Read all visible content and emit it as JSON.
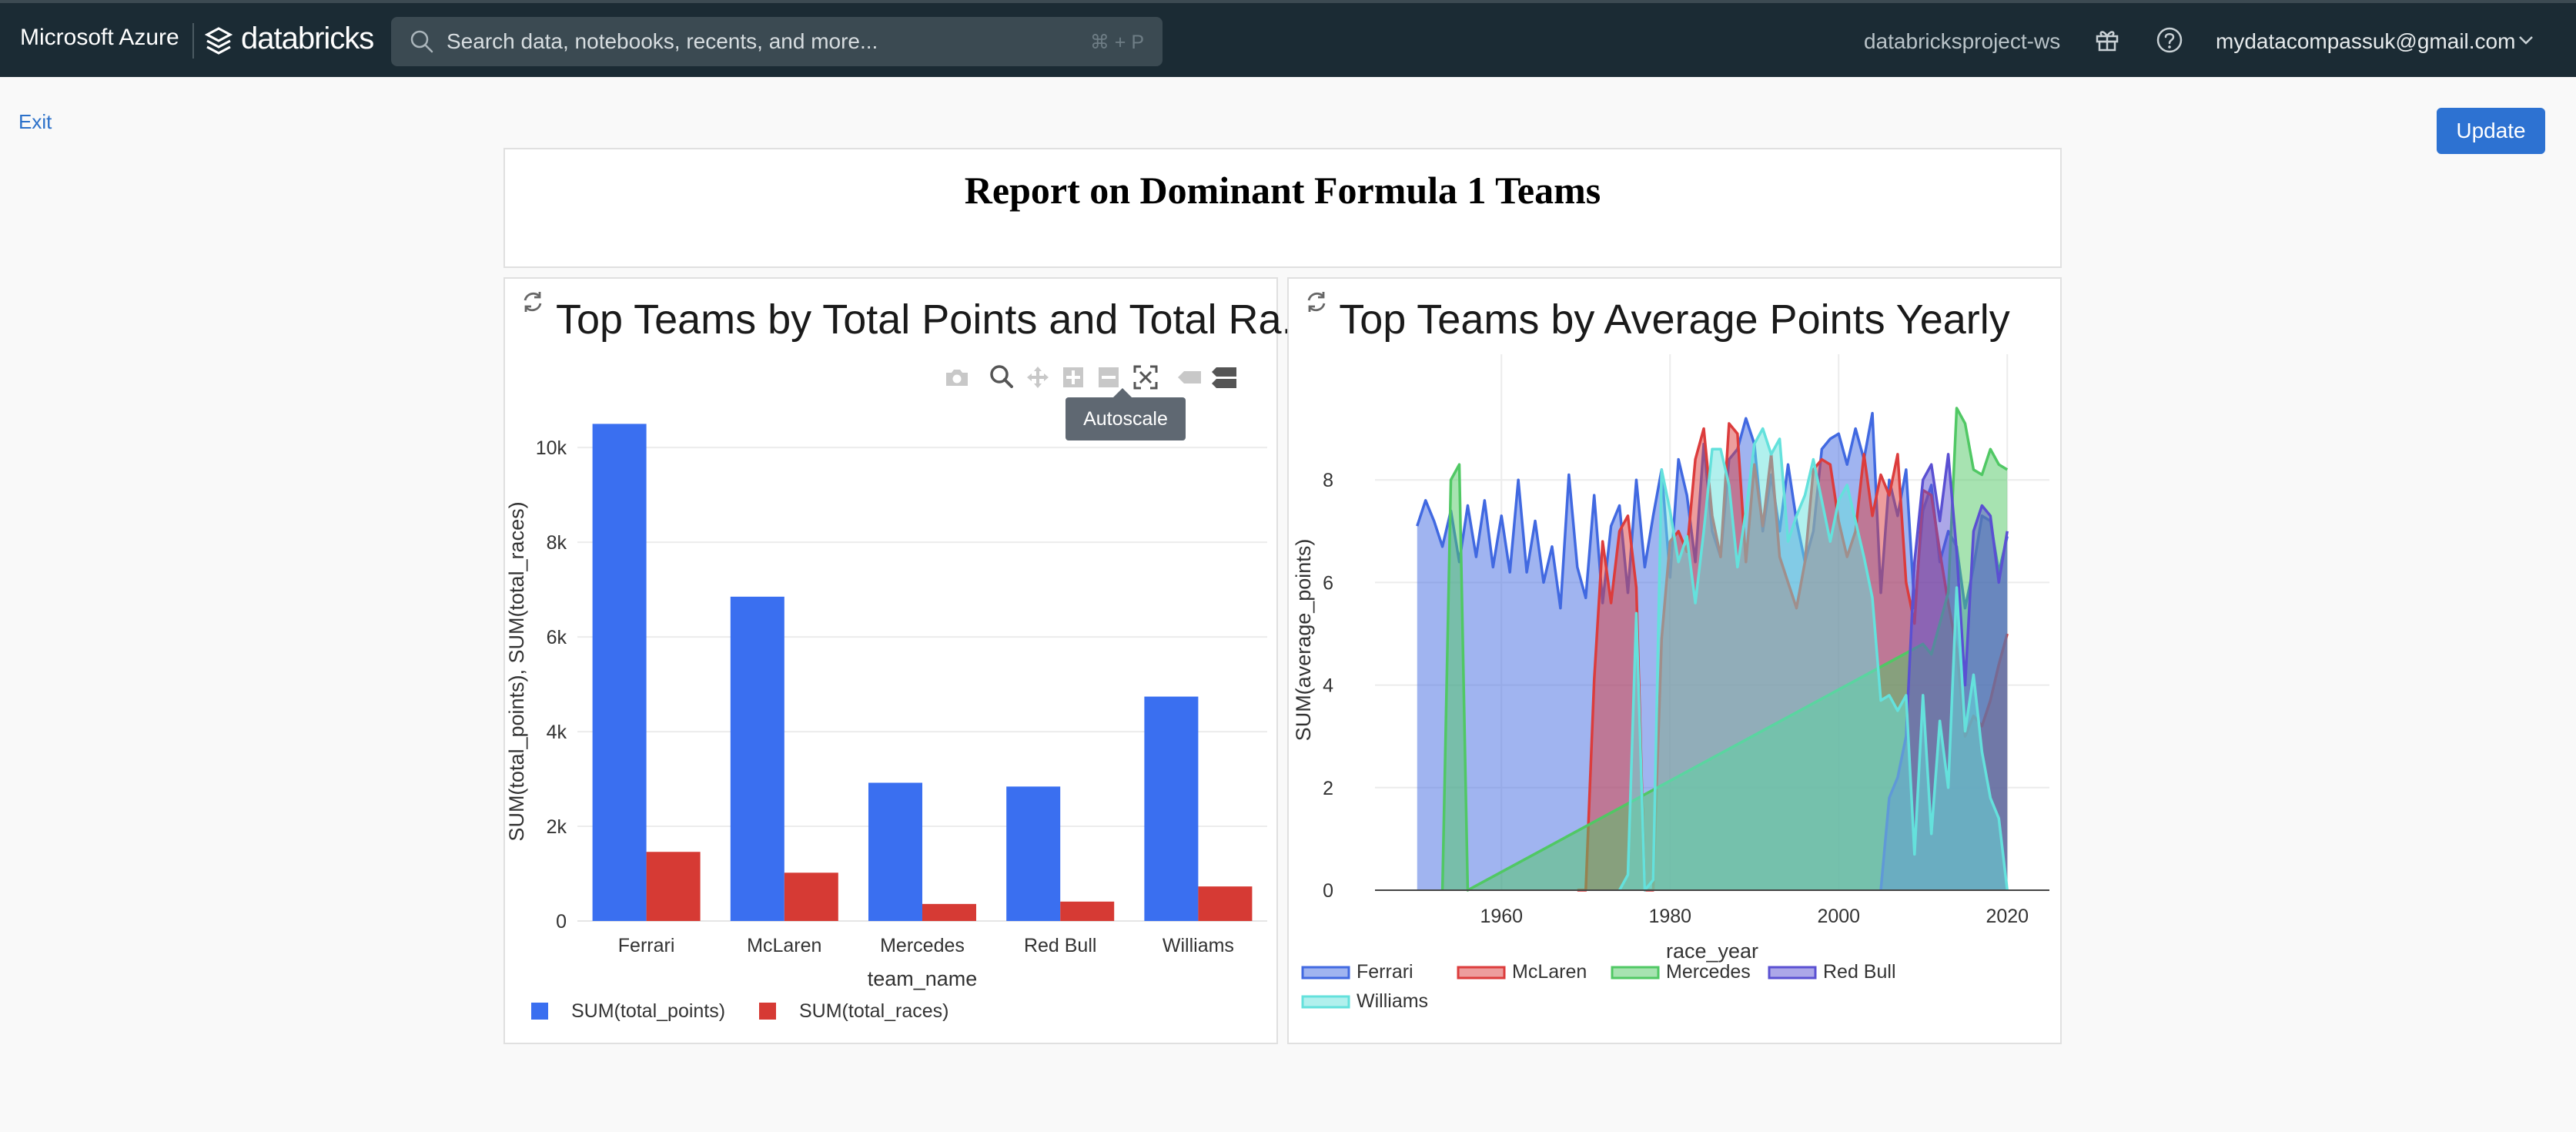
{
  "topbar": {
    "brand": "Microsoft Azure",
    "product": "databricks",
    "search_placeholder": "Search data, notebooks, recents, and more...",
    "search_shortcut": "⌘ + P",
    "workspace": "databricksproject-ws",
    "user": "mydatacompassuk@gmail.com",
    "icons": [
      "databricks-logo-icon",
      "search-icon",
      "gift-icon",
      "help-icon",
      "chevron-down-icon"
    ]
  },
  "dashboard": {
    "exit_label": "Exit",
    "update_label": "Update",
    "report_title": "Report on Dominant Formula 1 Teams"
  },
  "chart1": {
    "title": "Top Teams by Total Points and Total Ra...",
    "tooltip": "Autoscale",
    "toolbar_icons": [
      "camera-icon",
      "zoom-icon",
      "pan-icon",
      "zoom-in-icon",
      "zoom-out-icon",
      "autoscale-icon",
      "hover-closest-icon",
      "hover-compare-icon"
    ]
  },
  "chart2": {
    "title": "Top Teams by Average Points Yearly"
  },
  "colors": {
    "blue": "#3a6ff0",
    "red": "#d63a34",
    "ferrari": "#4169e1",
    "mclaren": "#dc3c3c",
    "mercedes": "#50c864",
    "redbull": "#5a50d2",
    "williams": "#64e1dc"
  },
  "chart_data": [
    {
      "type": "bar",
      "title": "Top Teams by Total Points and Total Ra...",
      "xlabel": "team_name",
      "ylabel": "SUM(total_points), SUM(total_races)",
      "categories": [
        "Ferrari",
        "McLaren",
        "Mercedes",
        "Red Bull",
        "Williams"
      ],
      "series": [
        {
          "name": "SUM(total_points)",
          "values": [
            10500,
            6850,
            2920,
            2840,
            4740
          ]
        },
        {
          "name": "SUM(total_races)",
          "values": [
            1460,
            1020,
            360,
            410,
            730
          ]
        }
      ],
      "ylim": [
        0,
        10800
      ],
      "yticks": [
        0,
        2000,
        4000,
        6000,
        8000,
        10000
      ],
      "ytick_labels": [
        "0",
        "2k",
        "4k",
        "6k",
        "8k",
        "10k"
      ],
      "grid": true,
      "legend": "bottom-left"
    },
    {
      "type": "area",
      "title": "Top Teams by Average Points Yearly",
      "xlabel": "race_year",
      "ylabel": "SUM(average_points)",
      "xlim": [
        1945,
        2025
      ],
      "ylim": [
        0,
        10
      ],
      "xticks": [
        1960,
        1980,
        2000,
        2020
      ],
      "yticks": [
        0,
        2,
        4,
        6,
        8
      ],
      "grid": true,
      "legend": "bottom-left",
      "series": [
        {
          "name": "Ferrari",
          "x": [
            1950,
            1951,
            1952,
            1953,
            1954,
            1955,
            1956,
            1957,
            1958,
            1959,
            1960,
            1961,
            1962,
            1963,
            1964,
            1965,
            1966,
            1967,
            1968,
            1969,
            1970,
            1971,
            1972,
            1973,
            1974,
            1975,
            1976,
            1977,
            1978,
            1979,
            1980,
            1981,
            1982,
            1983,
            1984,
            1985,
            1986,
            1987,
            1988,
            1989,
            1990,
            1991,
            1992,
            1993,
            1994,
            1995,
            1996,
            1997,
            1998,
            1999,
            2000,
            2001,
            2002,
            2003,
            2004,
            2005,
            2006,
            2007,
            2008,
            2009,
            2010,
            2011,
            2012,
            2013,
            2014,
            2015,
            2016,
            2017,
            2018,
            2019,
            2020
          ],
          "y": [
            7.1,
            7.6,
            7.2,
            6.7,
            7.4,
            6.4,
            7.5,
            6.5,
            7.6,
            6.3,
            7.3,
            6.2,
            8.0,
            6.2,
            7.2,
            6.0,
            6.7,
            5.5,
            8.1,
            6.3,
            5.7,
            7.7,
            5.6,
            7.1,
            7.5,
            5.8,
            8.0,
            6.3,
            7.3,
            8.2,
            6.1,
            8.4,
            7.7,
            6.4,
            8.7,
            7.0,
            6.5,
            8.4,
            8.6,
            9.2,
            8.7,
            7.0,
            8.1,
            7.0,
            8.3,
            7.2,
            6.4,
            7.0,
            8.6,
            8.8,
            8.9,
            8.3,
            9.0,
            8.4,
            9.3,
            5.8,
            8.0,
            7.3,
            8.2,
            5.5,
            7.4,
            7.9,
            6.4,
            7.0,
            6.7,
            5.5,
            6.3,
            7.3,
            7.2,
            6.2,
            6.9
          ]
        },
        {
          "name": "McLaren",
          "x": [
            1969,
            1970,
            1971,
            1972,
            1973,
            1974,
            1975,
            1976,
            1977,
            1978,
            1979,
            1980,
            1981,
            1982,
            1983,
            1984,
            1985,
            1986,
            1987,
            1988,
            1989,
            1990,
            1991,
            1992,
            1993,
            1994,
            1995,
            1996,
            1997,
            1998,
            1999,
            2000,
            2001,
            2002,
            2003,
            2004,
            2005,
            2006,
            2007,
            2008,
            2009,
            2010,
            2011,
            2012,
            2013,
            2014,
            2015,
            2016,
            2017,
            2018,
            2019,
            2020
          ],
          "y": [
            0,
            0,
            4.1,
            6.8,
            5.6,
            7.0,
            7.3,
            5.9,
            0,
            0,
            4.9,
            6.8,
            7.0,
            6.6,
            8.4,
            9.0,
            7.3,
            6.5,
            9.1,
            8.9,
            6.4,
            8.3,
            7.1,
            8.5,
            6.5,
            6.0,
            5.5,
            6.4,
            8.2,
            8.4,
            8.3,
            7.2,
            6.5,
            7.0,
            8.5,
            7.3,
            8.1,
            7.7,
            8.5,
            6.0,
            5.2,
            7.8,
            7.7,
            6.6,
            5.6,
            4.7,
            3.0,
            3.4,
            3.2,
            3.7,
            4.4,
            5.0
          ]
        },
        {
          "name": "Mercedes",
          "x": [
            1953,
            1954,
            1955,
            1956,
            2010,
            2011,
            2012,
            2013,
            2014,
            2015,
            2016,
            2017,
            2018,
            2019,
            2020
          ],
          "y": [
            0,
            8.0,
            8.3,
            0,
            4.8,
            4.6,
            5.2,
            5.8,
            9.4,
            9.1,
            8.2,
            8.1,
            8.6,
            8.3,
            8.2
          ]
        },
        {
          "name": "Red Bull",
          "x": [
            2005,
            2006,
            2007,
            2008,
            2009,
            2010,
            2011,
            2012,
            2013,
            2014,
            2015,
            2016,
            2017,
            2018,
            2019,
            2020
          ],
          "y": [
            0,
            1.8,
            2.2,
            3.0,
            6.4,
            8.0,
            8.3,
            7.2,
            8.5,
            6.6,
            4.0,
            7.0,
            7.5,
            7.3,
            6.0,
            7.0
          ]
        },
        {
          "name": "Williams",
          "x": [
            1974,
            1975,
            1976,
            1977,
            1978,
            1979,
            1980,
            1981,
            1982,
            1983,
            1984,
            1985,
            1986,
            1987,
            1988,
            1989,
            1990,
            1991,
            1992,
            1993,
            1994,
            1995,
            1996,
            1997,
            1998,
            1999,
            2000,
            2001,
            2002,
            2003,
            2004,
            2005,
            2006,
            2007,
            2008,
            2009,
            2010,
            2011,
            2012,
            2013,
            2014,
            2015,
            2016,
            2017,
            2018,
            2019,
            2020
          ],
          "y": [
            0,
            0.3,
            5.4,
            0,
            0.2,
            8.2,
            7.4,
            6.4,
            6.9,
            5.6,
            7.0,
            8.6,
            8.6,
            7.9,
            6.3,
            7.4,
            8.7,
            9.0,
            8.5,
            8.8,
            6.8,
            7.3,
            7.7,
            8.4,
            7.6,
            6.8,
            7.6,
            7.9,
            7.2,
            6.5,
            5.7,
            3.7,
            3.8,
            3.5,
            3.8,
            0.7,
            3.8,
            1.1,
            3.3,
            2.0,
            5.9,
            3.1,
            4.2,
            2.7,
            1.8,
            1.4,
            0.0
          ]
        }
      ]
    }
  ]
}
